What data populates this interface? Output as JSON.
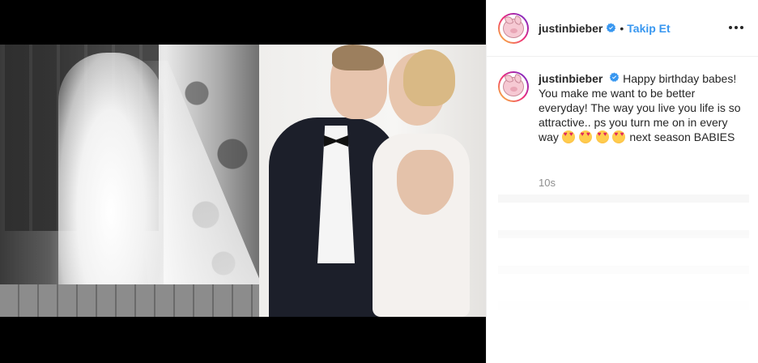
{
  "post": {
    "username": "justinbieber",
    "separator": "•",
    "follow_label": "Takip Et",
    "caption": "Happy birthday babes! You make me want to be better everyday! The way you live you life is so attractive.. ps you turn me on in every way",
    "caption_tail": "next season BABIES",
    "emojis": [
      "star-struck-emoji",
      "star-struck-emoji",
      "star-struck-emoji",
      "star-struck-emoji"
    ],
    "time_ago": "10s"
  },
  "colors": {
    "accent": "#3897f0",
    "verified": "#3897f0",
    "text": "#262626",
    "muted": "#8e8e8e",
    "media_bg": "#000000"
  },
  "icons": {
    "verified": "verified-badge-icon",
    "more": "more-options-icon",
    "avatar": "pig-avatar-icon"
  }
}
